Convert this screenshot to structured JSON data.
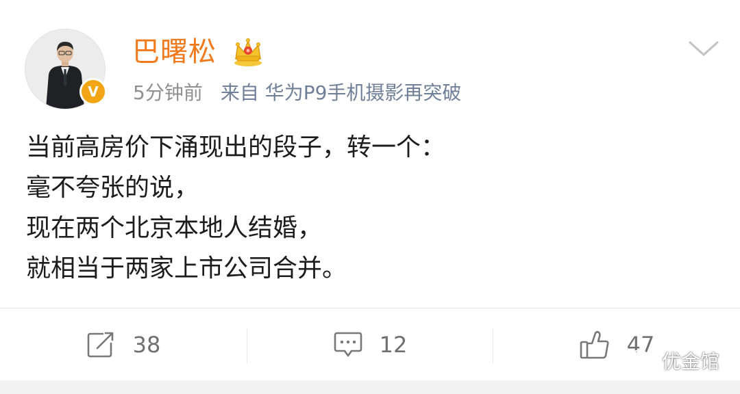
{
  "post": {
    "author": {
      "name": "巴曙松",
      "verified_badge": "V"
    },
    "meta": {
      "time": "5分钟前",
      "source": "来自 华为P9手机摄影再突破"
    },
    "content_lines": [
      "当前高房价下涌现出的段子，转一个：",
      "毫不夸张的说，",
      "现在两个北京本地人结婚，",
      "就相当于两家上市公司合并。"
    ]
  },
  "actions": {
    "repost": {
      "icon": "edit-share-icon",
      "count": "38"
    },
    "comment": {
      "icon": "comment-bubble-icon",
      "count": "12"
    },
    "like": {
      "icon": "thumbs-up-icon",
      "count": "47"
    }
  },
  "watermark": {
    "icon": "wechat-icon",
    "text": "优金馆"
  },
  "colors": {
    "username": "#f07b1e",
    "verified_badge": "#f2a615",
    "meta_time": "#8f8f8f",
    "meta_source": "#6f7f97",
    "content_text": "#1c1c1c",
    "action_icon": "#777777"
  }
}
